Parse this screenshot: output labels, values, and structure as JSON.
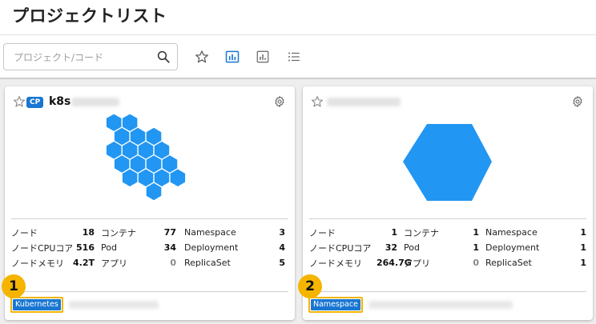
{
  "page": {
    "title": "プロジェクトリスト"
  },
  "search": {
    "placeholder": "プロジェクト/コード"
  },
  "toolbar": {
    "icons": [
      "star-icon",
      "bar-chart-icon",
      "chart-box-icon",
      "list-icon"
    ],
    "active": "bar-chart-icon",
    "accent": "#1976d2"
  },
  "cards": [
    {
      "badge": "CP",
      "name": "k8s",
      "tag": "Kubernetes",
      "stats": [
        [
          "ノード",
          "18",
          "コンテナ",
          "77",
          "Namespace",
          "3"
        ],
        [
          "ノードCPUコア",
          "516",
          "Pod",
          "34",
          "Deployment",
          "4"
        ],
        [
          "ノードメモリ",
          "4.2T",
          "アプリ",
          "0",
          "ReplicaSet",
          "5"
        ]
      ],
      "callout": "1"
    },
    {
      "badge": "",
      "name": "",
      "tag": "Namespace",
      "stats": [
        [
          "ノード",
          "1",
          "コンテナ",
          "1",
          "Namespace",
          "1"
        ],
        [
          "ノードCPUコア",
          "32",
          "Pod",
          "1",
          "Deployment",
          "1"
        ],
        [
          "ノードメモリ",
          "264.7G",
          "アプリ",
          "0",
          "ReplicaSet",
          "1"
        ]
      ],
      "callout": "2"
    }
  ],
  "colors": {
    "hex": "#2196f3",
    "callout": "#f5b400",
    "badge": "#1976d2"
  }
}
